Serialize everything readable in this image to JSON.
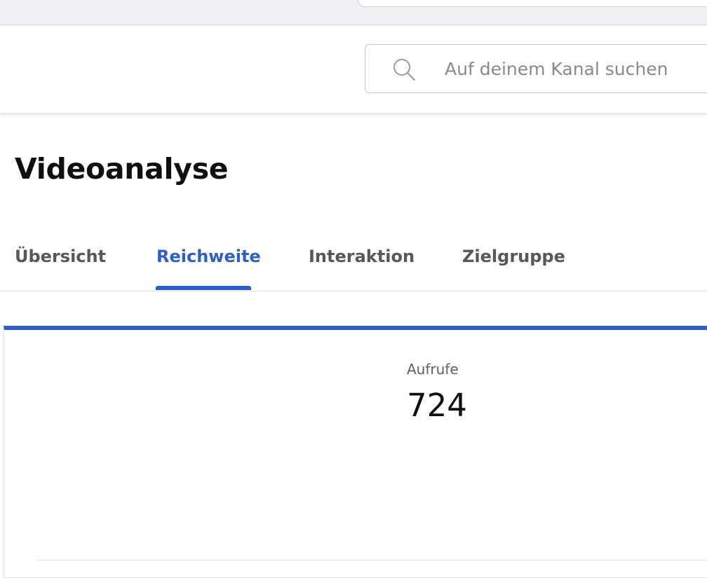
{
  "header": {
    "search": {
      "placeholder": "Auf deinem Kanal suchen",
      "icon": "search-icon"
    }
  },
  "page": {
    "title": "Videoanalyse"
  },
  "tabs": [
    {
      "label": "Übersicht",
      "active": false
    },
    {
      "label": "Reichweite",
      "active": true
    },
    {
      "label": "Interaktion",
      "active": false
    },
    {
      "label": "Zielgruppe",
      "active": false
    }
  ],
  "metric": {
    "label": "Aufrufe",
    "value": "724"
  },
  "colors": {
    "accent": "#2e5fc7",
    "text_primary": "#0f0f0f",
    "text_secondary": "#585858"
  }
}
